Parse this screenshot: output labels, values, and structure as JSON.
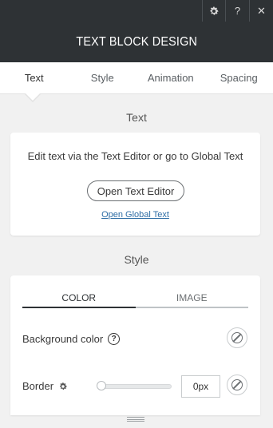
{
  "top_icons": {
    "settings": "settings-icon",
    "help_glyph": "?",
    "close_glyph": "✕"
  },
  "header": {
    "title": "TEXT BLOCK DESIGN"
  },
  "tabs": [
    {
      "label": "Text",
      "active": true
    },
    {
      "label": "Style",
      "active": false
    },
    {
      "label": "Animation",
      "active": false
    },
    {
      "label": "Spacing",
      "active": false
    }
  ],
  "text_section": {
    "title": "Text",
    "description": "Edit text via the Text Editor or go to Global Text",
    "open_editor_label": "Open Text Editor",
    "open_global_label": "Open Global Text"
  },
  "style_section": {
    "title": "Style",
    "segments": [
      {
        "label": "COLOR",
        "active": true
      },
      {
        "label": "IMAGE",
        "active": false
      }
    ],
    "background_color_label": "Background color",
    "help_glyph": "?",
    "border_label": "Border",
    "border_value": "0px",
    "border_slider_value": 0
  },
  "colors": {
    "header_bg": "#2e3235",
    "panel_bg": "#f1f1f1",
    "link": "#2f6ea5"
  }
}
